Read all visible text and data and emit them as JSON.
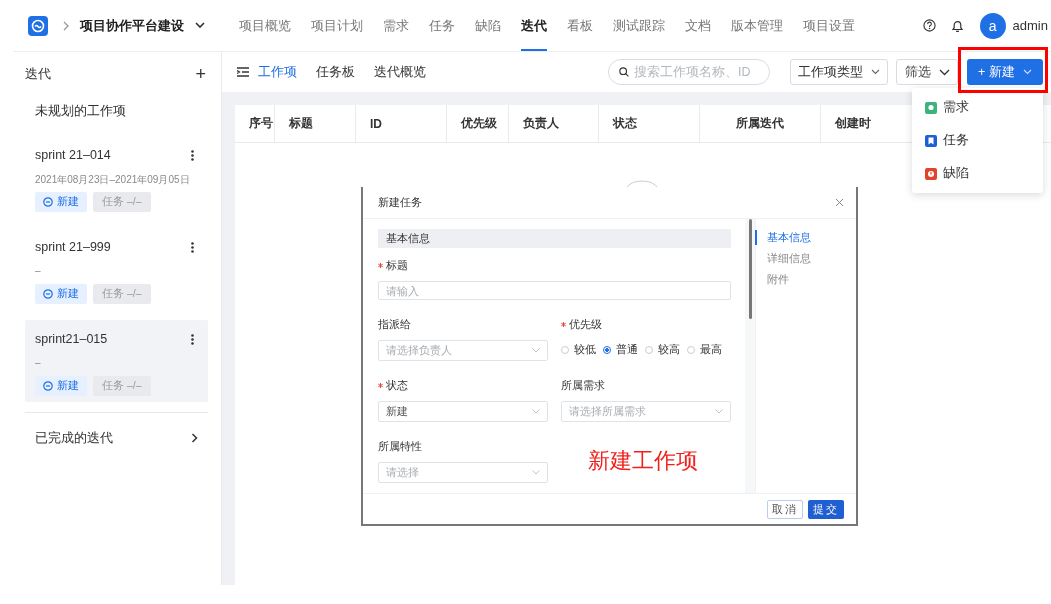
{
  "header": {
    "project": "项目协作平台建设",
    "nav": [
      {
        "label": "项目概览",
        "selected": false
      },
      {
        "label": "项目计划",
        "selected": false
      },
      {
        "label": "需求",
        "selected": false
      },
      {
        "label": "任务",
        "selected": false
      },
      {
        "label": "缺陷",
        "selected": false
      },
      {
        "label": "迭代",
        "selected": true
      },
      {
        "label": "看板",
        "selected": false
      },
      {
        "label": "测试跟踪",
        "selected": false
      },
      {
        "label": "文档",
        "selected": false
      },
      {
        "label": "版本管理",
        "selected": false
      },
      {
        "label": "项目设置",
        "selected": false
      }
    ],
    "avatar": "a",
    "user": "admin"
  },
  "sidebar": {
    "title": "迭代",
    "add": "+",
    "unplanned": "未规划的工作项",
    "sprints": [
      {
        "name": "sprint 21–014",
        "dates": "2021年08月23日–2021年09月05日",
        "status": "新建",
        "tasks": "任务 –/–",
        "selected": false
      },
      {
        "name": "sprint 21–999",
        "dates": "–",
        "status": "新建",
        "tasks": "任务 –/–",
        "selected": false
      },
      {
        "name": "sprint21–015",
        "dates": "–",
        "status": "新建",
        "tasks": "任务 –/–",
        "selected": true
      }
    ],
    "completed": "已完成的迭代"
  },
  "toolbar": {
    "views": [
      {
        "label": "工作项",
        "selected": true
      },
      {
        "label": "任务板",
        "selected": false
      },
      {
        "label": "迭代概览",
        "selected": false
      }
    ],
    "search": {
      "placeholder": "搜索工作项名称、ID"
    },
    "type_filter": "工作项类型",
    "filter": "筛选",
    "new_button": "+ 新建"
  },
  "table": {
    "columns": [
      "序号",
      "标题",
      "ID",
      "优先级",
      "负责人",
      "状态",
      "所属迭代",
      "创建时"
    ]
  },
  "new_menu": [
    {
      "label": "需求",
      "color": "#3cb37a"
    },
    {
      "label": "任务",
      "color": "#1e5fd6"
    },
    {
      "label": "缺陷",
      "color": "#e0452b"
    }
  ],
  "dialog": {
    "title": "新建任务",
    "section": "基本信息",
    "fields": [
      {
        "label": "标题",
        "required": true,
        "kind": "input",
        "placeholder": "请输入"
      },
      {
        "label": "指派给",
        "required": false,
        "kind": "select",
        "placeholder": "请选择负责人"
      },
      {
        "label": "优先级",
        "required": true,
        "kind": "radio",
        "options": [
          {
            "label": "较低",
            "selected": false
          },
          {
            "label": "普通",
            "selected": true
          },
          {
            "label": "较高",
            "selected": false
          },
          {
            "label": "最高",
            "selected": false
          }
        ]
      },
      {
        "label": "状态",
        "required": true,
        "kind": "select",
        "value": "新建"
      },
      {
        "label": "所属需求",
        "required": false,
        "kind": "select",
        "placeholder": "请选择所属需求"
      },
      {
        "label": "所属特性",
        "required": false,
        "kind": "select",
        "placeholder": "请选择"
      }
    ],
    "anchors": [
      {
        "label": "基本信息",
        "selected": true
      },
      {
        "label": "详细信息",
        "selected": false
      },
      {
        "label": "附件",
        "selected": false
      }
    ],
    "cancel": "取消",
    "submit": "提交"
  },
  "annotation": "新建工作项"
}
